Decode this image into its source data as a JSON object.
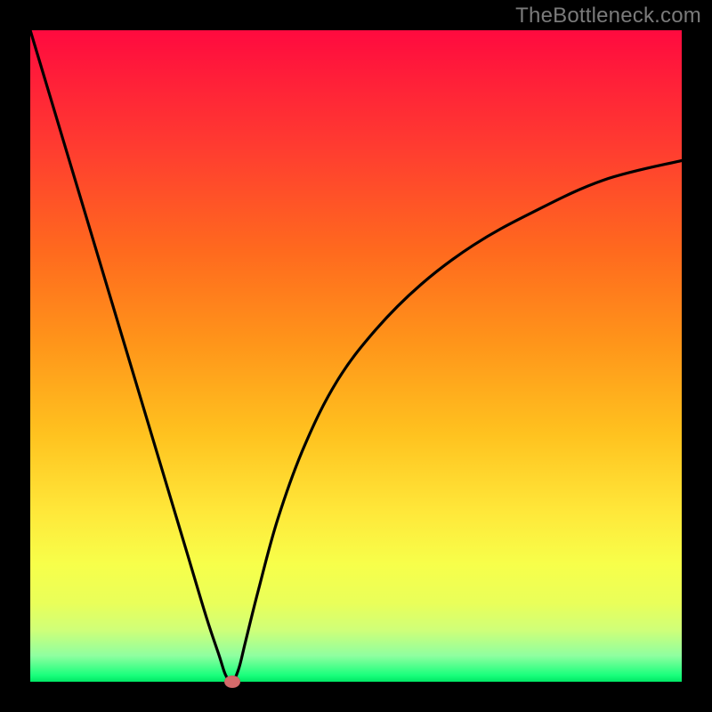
{
  "watermark": "TheBottleneck.com",
  "colors": {
    "page_bg": "#000000",
    "curve_stroke": "#000000",
    "marker_fill": "#d46a6a",
    "gradient_stops": [
      "#ff0a3f",
      "#ff1b3a",
      "#ff3c30",
      "#ff6a1e",
      "#ff951a",
      "#ffc21f",
      "#ffe83a",
      "#f7ff4a",
      "#e9ff5a",
      "#d0ff78",
      "#8fffa0",
      "#1aff7c",
      "#00e765"
    ]
  },
  "chart_data": {
    "type": "line",
    "title": "",
    "xlabel": "",
    "ylabel": "",
    "xlim": [
      0,
      100
    ],
    "ylim": [
      0,
      100
    ],
    "grid": false,
    "legend": false,
    "notes": "V-shaped bottleneck curve. Minimum (zero) near x≈31; steep left branch, asymptotic right branch rising to ~80% at x=100. Y-axis encoded by background gradient (green=0 at bottom, red=100 at top).",
    "series": [
      {
        "name": "bottleneck",
        "x": [
          0,
          3,
          6,
          9,
          12,
          15,
          18,
          21,
          24,
          27,
          29,
          30,
          31,
          32,
          33,
          35,
          38,
          42,
          47,
          53,
          60,
          68,
          77,
          88,
          100
        ],
        "values": [
          100,
          90,
          80,
          70,
          60,
          50,
          40,
          30,
          20,
          10,
          4,
          1,
          0,
          2,
          6,
          14,
          25,
          36,
          46,
          54,
          61,
          67,
          72,
          77,
          80
        ]
      }
    ],
    "marker": {
      "x": 31,
      "y": 0
    }
  }
}
